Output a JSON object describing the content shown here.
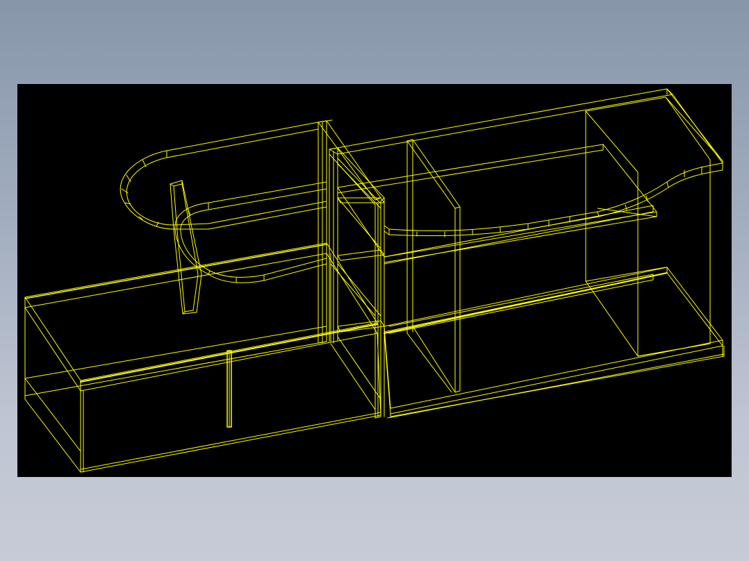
{
  "viewport": {
    "background_color": "#000000",
    "line_color": "#ffff00"
  },
  "drawing": {
    "parts": [
      "left-base-cabinet",
      "left-cabinet-divider",
      "left-upper-curved-shelf",
      "left-support-leg",
      "center-tall-column",
      "right-base-cabinet",
      "right-cabinet-divider",
      "right-upper-curved-shelf",
      "right-end-panel"
    ]
  }
}
